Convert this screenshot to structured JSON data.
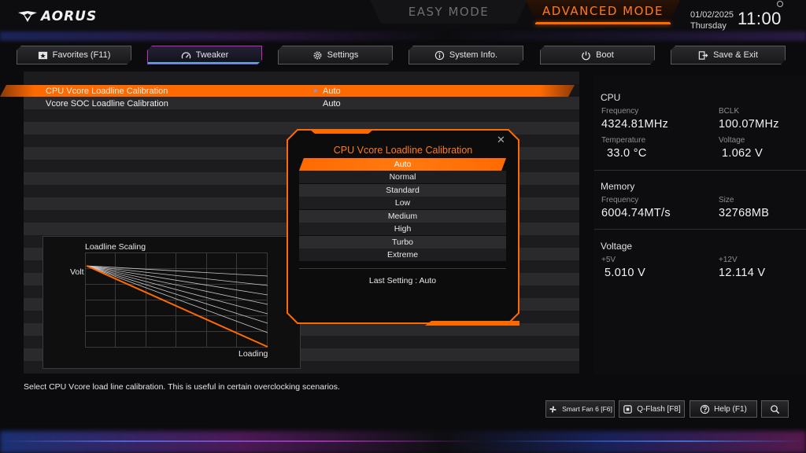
{
  "brand": {
    "logo_text": "AORUS",
    "logo_icon": "aorus-eagle-icon"
  },
  "modes": {
    "easy": "EASY MODE",
    "advanced": "ADVANCED MODE"
  },
  "clock": {
    "date": "01/02/2025",
    "weekday": "Thursday",
    "time": "11:00"
  },
  "tabs": [
    {
      "label": "Favorites (F11)",
      "icon": "favorites-icon"
    },
    {
      "label": "Tweaker",
      "icon": "speedometer-icon",
      "active": true
    },
    {
      "label": "Settings",
      "icon": "gear-icon"
    },
    {
      "label": "System Info.",
      "icon": "info-icon"
    },
    {
      "label": "Boot",
      "icon": "power-icon"
    },
    {
      "label": "Save & Exit",
      "icon": "exit-icon"
    }
  ],
  "settings": [
    {
      "label": "CPU Vcore Loadline Calibration",
      "value": "Auto",
      "selected": true
    },
    {
      "label": "Vcore SOC Loadline Calibration",
      "value": "Auto"
    }
  ],
  "graph": {
    "title": "Loadline Scaling",
    "y_label": "Volt",
    "x_label": "Loading"
  },
  "popup": {
    "title": "CPU Vcore Loadline Calibration",
    "options": [
      "Auto",
      "Normal",
      "Standard",
      "Low",
      "Medium",
      "High",
      "Turbo",
      "Extreme"
    ],
    "selected": "Auto",
    "last_setting": "Last Setting : Auto"
  },
  "info": {
    "cpu": {
      "heading": "CPU",
      "frequency_label": "Frequency",
      "frequency": "4324.81MHz",
      "bclk_label": "BCLK",
      "bclk": "100.07MHz",
      "temperature_label": "Temperature",
      "temperature": "33.0 °C",
      "voltage_label": "Voltage",
      "voltage": "1.062 V"
    },
    "memory": {
      "heading": "Memory",
      "frequency_label": "Frequency",
      "frequency": "6004.74MT/s",
      "size_label": "Size",
      "size": "32768MB"
    },
    "voltage": {
      "heading": "Voltage",
      "v5_label": "+5V",
      "v5": "5.010 V",
      "v12_label": "+12V",
      "v12": "12.114 V"
    }
  },
  "help_text": "Select CPU Vcore load line calibration. This is useful in certain overclocking scenarios.",
  "bottom_buttons": [
    {
      "label": "Smart Fan 6 [F6]",
      "icon": "fan-icon"
    },
    {
      "label": "Q-Flash [F8]",
      "icon": "chip-icon"
    },
    {
      "label": "Help (F1)",
      "icon": "help-icon"
    },
    {
      "label": "",
      "icon": "search-icon"
    }
  ],
  "colors": {
    "accent": "#ff6a00",
    "active_tab_border": "#d020c8",
    "active_tab_glow": "#1ec8e0"
  }
}
